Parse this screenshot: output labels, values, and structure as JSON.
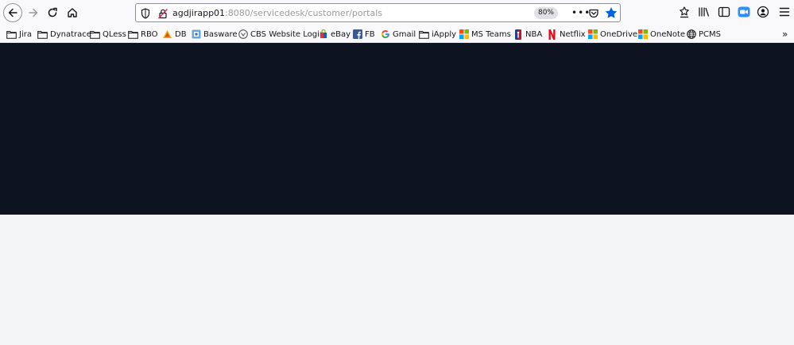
{
  "urlbar": {
    "host": "agdjirapp01",
    "path": ":8080/servicedesk/customer/portals",
    "zoom": "80%",
    "more": "•••"
  },
  "bookmarks": {
    "items": [
      {
        "label": "Jira",
        "icon": "folder-icon"
      },
      {
        "label": "Dynatrace",
        "icon": "folder-icon"
      },
      {
        "label": "QLess",
        "icon": "folder-icon"
      },
      {
        "label": "RBO",
        "icon": "folder-icon"
      },
      {
        "label": "DB",
        "icon": "db-icon"
      },
      {
        "label": "Basware",
        "icon": "basware-icon"
      },
      {
        "label": "CBS Website Login",
        "icon": "cbs-icon"
      },
      {
        "label": "eBay",
        "icon": "ebay-icon"
      },
      {
        "label": "FB",
        "icon": "facebook-icon"
      },
      {
        "label": "Gmail",
        "icon": "google-icon"
      },
      {
        "label": "iApply",
        "icon": "folder-icon"
      },
      {
        "label": "MS Teams",
        "icon": "microsoft-icon"
      },
      {
        "label": "NBA",
        "icon": "nba-icon"
      },
      {
        "label": "Netflix",
        "icon": "netflix-icon"
      },
      {
        "label": "OneDrive",
        "icon": "microsoft-icon"
      },
      {
        "label": "OneNote",
        "icon": "microsoft-icon"
      },
      {
        "label": "PCMS",
        "icon": "globe-icon"
      }
    ],
    "overflow": "»"
  },
  "colors": {
    "hero": "#0d1321",
    "page_bg": "#f4f5f7",
    "star": "#0061e0",
    "zoom_app": "#2d8cff"
  }
}
